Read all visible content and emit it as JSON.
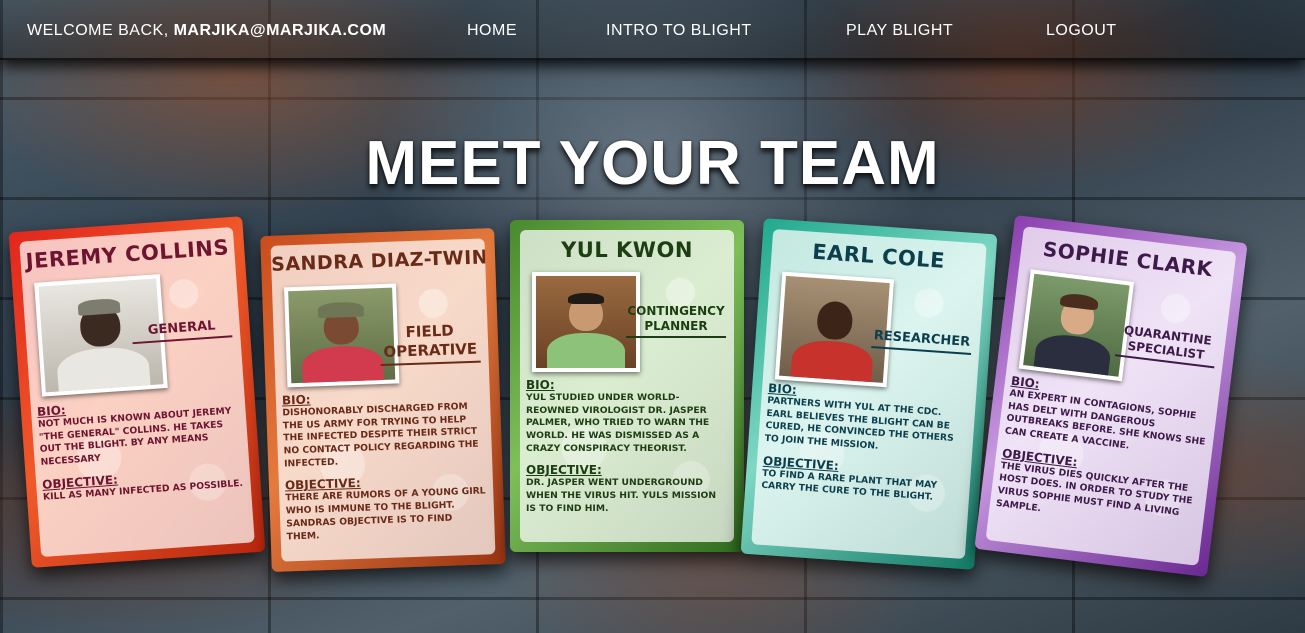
{
  "nav": {
    "welcome_prefix": "WELCOME BACK, ",
    "welcome_user": "MARJIKA@MARJIKA.COM",
    "home": "HOME",
    "intro": "INTRO TO BLIGHT",
    "play": "PLAY BLIGHT",
    "logout": "LOGOUT"
  },
  "page_title": "MEET YOUR TEAM",
  "cards": [
    {
      "name": "JEREMY COLLINS",
      "role": "GENERAL",
      "bio_label": "BIO:",
      "bio": "NOT MUCH IS KNOWN ABOUT JEREMY \"THE GENERAL\" COLLINS. HE TAKES OUT THE BLIGHT. BY ANY MEANS NECESSARY",
      "objective_label": "OBJECTIVE:",
      "objective": "KILL AS MANY INFECTED AS POSSIBLE."
    },
    {
      "name": "SANDRA DIAZ-TWINE",
      "role": "FIELD OPERATIVE",
      "bio_label": "BIO:",
      "bio": "DISHONORABLY DISCHARGED FROM THE US ARMY FOR TRYING TO HELP THE INFECTED DESPITE THEIR STRICT NO CONTACT POLICY REGARDING THE INFECTED.",
      "objective_label": "OBJECTIVE:",
      "objective": "THERE ARE RUMORS OF A YOUNG GIRL WHO IS IMMUNE TO THE BLIGHT. SANDRAS OBJECTIVE IS TO FIND THEM."
    },
    {
      "name": "YUL KWON",
      "role": "CONTINGENCY PLANNER",
      "bio_label": "BIO:",
      "bio": "YUL STUDIED UNDER WORLD-REOWNED VIROLOGIST DR. JASPER PALMER, WHO TRIED TO WARN THE WORLD. HE WAS DISMISSED AS A CRAZY CONSPIRACY THEORIST.",
      "objective_label": "OBJECTIVE:",
      "objective": "DR. JASPER WENT UNDERGROUND WHEN THE VIRUS HIT. YULS MISSION IS TO FIND HIM."
    },
    {
      "name": "EARL COLE",
      "role": "RESEARCHER",
      "bio_label": "BIO:",
      "bio": "PARTNERS WITH YUL AT THE CDC. EARL BELIEVES THE BLIGHT CAN BE CURED, HE CONVINCED THE OTHERS TO JOIN THE MISSION.",
      "objective_label": "OBJECTIVE:",
      "objective": "TO FIND A RARE PLANT THAT MAY CARRY THE CURE TO THE BLIGHT."
    },
    {
      "name": "SOPHIE CLARK",
      "role": "QUARANTINE SPECIALIST",
      "bio_label": "BIO:",
      "bio": "AN EXPERT IN CONTAGIONS, SOPHIE HAS DELT WITH DANGEROUS OUTBREAKS BEFORE. SHE KNOWS SHE CAN CREATE A VACCINE.",
      "objective_label": "OBJECTIVE:",
      "objective": "THE VIRUS DIES QUICKLY AFTER THE HOST DOES. IN ORDER TO STUDY THE VIRUS SOPHIE MUST FIND A LIVING SAMPLE."
    }
  ]
}
